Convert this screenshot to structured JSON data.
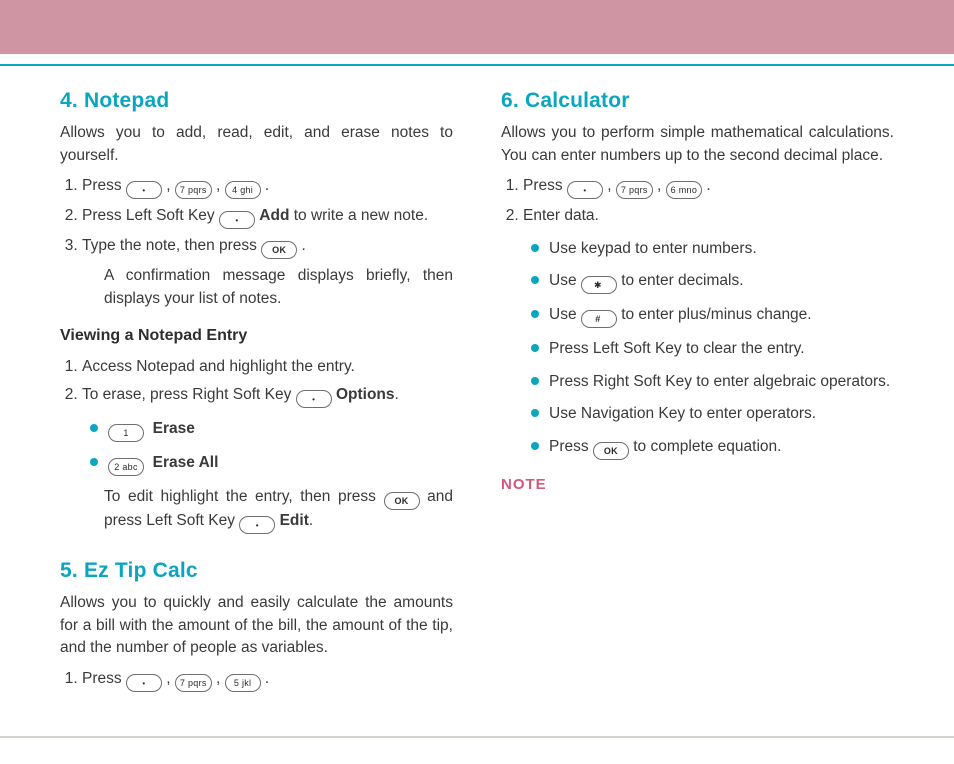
{
  "sections": {
    "notepad": {
      "heading": "4. Notepad",
      "intro": "Allows you to add, read, edit, and erase notes to yourself.",
      "step1_prefix": "Press ",
      "step2_prefix": "Press Left Soft Key ",
      "step2_bold": "Add",
      "step2_suffix": " to write a new note.",
      "step3": "Type the note, then press ",
      "step3_after": ".",
      "step3_sub": "A confirmation message displays briefly, then displays your list of notes.",
      "sub_heading": "Viewing a Notepad Entry",
      "v_step1": "Access Notepad and highlight the entry.",
      "v_step2_prefix": "To erase, press Right Soft Key ",
      "v_step2_bold": "Options",
      "v_step2_suffix": ".",
      "opt1": "Erase",
      "opt2": "Erase All",
      "edit_line_a": "To edit highlight the entry, then press ",
      "edit_line_b": " and press Left Soft Key ",
      "edit_bold": "Edit",
      "edit_suffix": "."
    },
    "eztip": {
      "heading": "5. Ez Tip Calc",
      "intro": "Allows you to quickly and easily calculate the amounts for a bill with the amount of the bill, the amount of the tip, and the number of people as variables.",
      "step1_prefix": "Press "
    },
    "calc": {
      "heading": "6. Calculator",
      "intro": "Allows you to perform simple mathematical calculations. You can enter numbers up to the second decimal place.",
      "step1_prefix": "Press ",
      "step2": "Enter data.",
      "b1": "Use keypad to enter numbers.",
      "b2_pre": "Use ",
      "b2_post": " to enter decimals.",
      "b3_pre": "Use ",
      "b3_post": " to enter plus/minus change.",
      "b4": "Press Left Soft Key to clear the entry.",
      "b5": "Press Right Soft Key to enter algebraic operators.",
      "b6": "Use Navigation Key to enter operators.",
      "b7_pre": "Press ",
      "b7_post": " to complete equation.",
      "note": "NOTE"
    }
  },
  "keys": {
    "dot": "·",
    "seven": "7 pqrs",
    "four": "4 ghi",
    "five": "5 jkl",
    "six": "6 mno",
    "one": "1",
    "two": "2 abc",
    "ok": "OK",
    "star": "",
    "hash": ""
  }
}
